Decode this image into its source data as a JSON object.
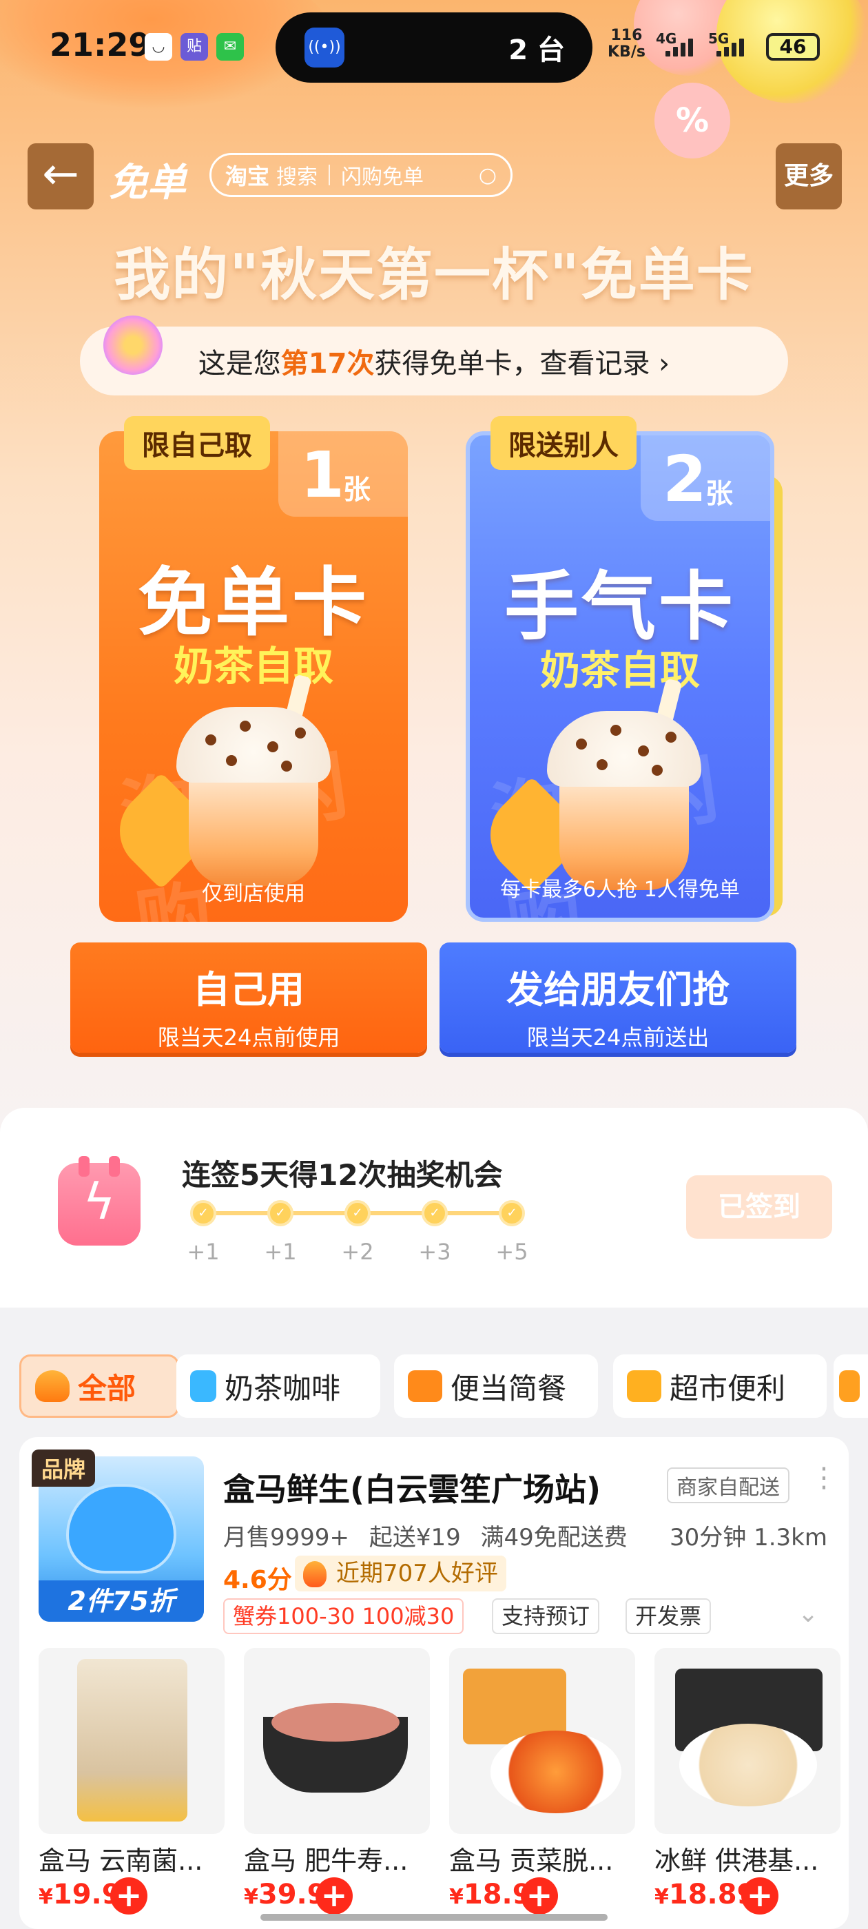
{
  "status_bar": {
    "time": "21:29",
    "island_text": "2 台",
    "net_speed": "116",
    "net_unit": "KB/s",
    "sig1": "4G",
    "sig2": "5G",
    "battery": "46"
  },
  "nav": {
    "title": "免单",
    "search_brand": "淘宝",
    "search_label": "搜索",
    "search_hint": "闪购免单",
    "more": "更多"
  },
  "hero": {
    "title": "我的\"秋天第一杯\"免单卡",
    "record_pre": "这是您",
    "record_highlight": "第17次",
    "record_post": "获得免单卡，查看记录 ›"
  },
  "cards": [
    {
      "tag": "限自己取",
      "count": "1",
      "unit": "张",
      "name": "免单卡",
      "sub": "奶茶自取",
      "watermark": "淘宝闪购",
      "foot": "仅到店使用"
    },
    {
      "tag": "限送别人",
      "count": "2",
      "unit": "张",
      "name": "手气卡",
      "sub": "奶茶自取",
      "watermark": "淘宝闪购",
      "foot": "每卡最多6人抢 1人得免单"
    }
  ],
  "actions": {
    "self_title": "自己用",
    "self_sub": "限当天24点前使用",
    "share_title": "发给朋友们抢",
    "share_sub": "限当天24点前送出"
  },
  "signin": {
    "title": "连签5天得12次抽奖机会",
    "steps": [
      "+1",
      "+1",
      "+2",
      "+3",
      "+5"
    ],
    "button": "已签到"
  },
  "categories": [
    {
      "label": "全部",
      "icon": "rice-bowl-icon",
      "active": true
    },
    {
      "label": "奶茶咖啡",
      "icon": "cup-icon",
      "active": false
    },
    {
      "label": "便当简餐",
      "icon": "bento-icon",
      "active": false
    },
    {
      "label": "超市便利",
      "icon": "store-icon",
      "active": false
    }
  ],
  "store": {
    "badge": "品牌",
    "promo": "2件75折",
    "name": "盒马鲜生(白云雲笙广场站)",
    "delivery": "商家自配送",
    "monthly_sales": "月售9999+",
    "min_order": "起送¥19",
    "free_delivery": "满49免配送费",
    "eta": "30分钟  1.3km",
    "rating": "4.6分",
    "review": "近期707人好评",
    "tags": [
      "蟹券100-30 100减30",
      "支持预订",
      "开发票"
    ]
  },
  "products": [
    {
      "name": "盒马 云南菌...",
      "currency": "¥",
      "price": "19.9"
    },
    {
      "name": "盒马 肥牛寿...",
      "currency": "¥",
      "price": "39.9"
    },
    {
      "name": "盒马 贡菜脱...",
      "currency": "¥",
      "price": "18.9"
    },
    {
      "name": "冰鲜 供港基...",
      "currency": "¥",
      "price": "18.89"
    }
  ],
  "colors": {
    "accent_orange": "#ff6a10",
    "accent_blue": "#3f67f5",
    "price_red": "#ff2a1a"
  }
}
